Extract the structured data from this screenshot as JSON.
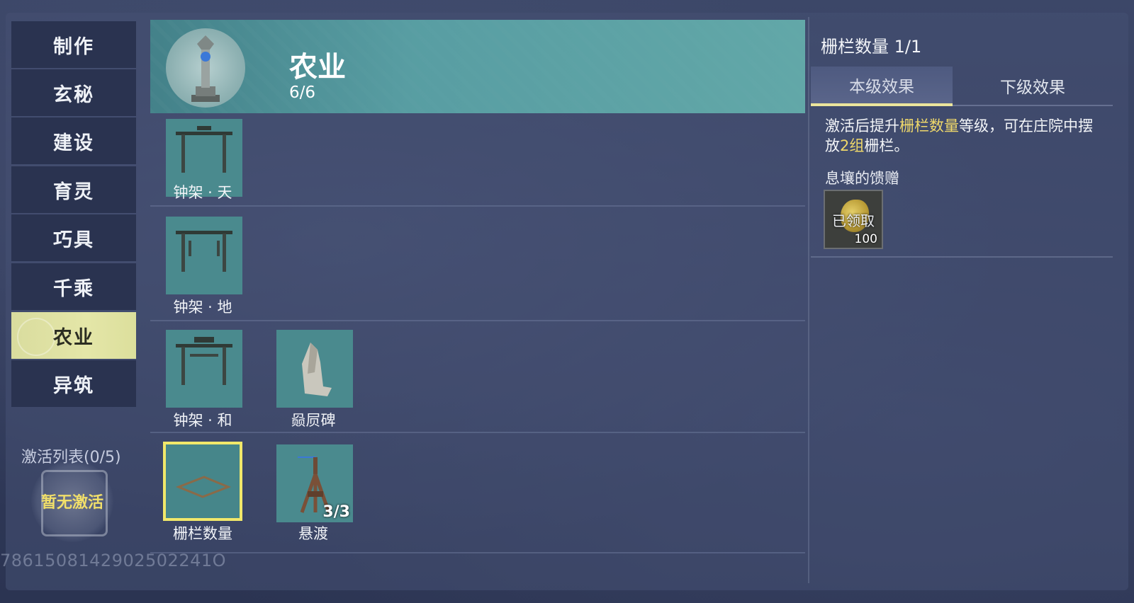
{
  "categories": [
    {
      "label": "制作"
    },
    {
      "label": "玄秘"
    },
    {
      "label": "建设"
    },
    {
      "label": "育灵"
    },
    {
      "label": "巧具"
    },
    {
      "label": "千乘"
    },
    {
      "label": "农业",
      "active": true
    },
    {
      "label": "异筑"
    }
  ],
  "activation": {
    "label": "激活列表(0/5)",
    "empty_text": "暂无激活"
  },
  "uid": "7861508142902502241O",
  "banner": {
    "title": "农业",
    "count": "6/6"
  },
  "items": [
    {
      "label": "钟架 · 天"
    },
    {
      "label": "钟架 · 地"
    },
    {
      "label": "钟架 · 和"
    },
    {
      "label": "赑屃碑"
    },
    {
      "label": "栅栏数量",
      "selected": true
    },
    {
      "label": "悬渡",
      "count": "3/3"
    }
  ],
  "detail": {
    "title": "栅栏数量 1/1",
    "tab_current": "本级效果",
    "tab_next": "下级效果",
    "desc_part1": "激活后提升",
    "desc_highlight1": "栅栏数量",
    "desc_part2": "等级，可在庄院中摆放",
    "desc_highlight2": "2组",
    "desc_part3": "栅栏。",
    "gift_label": "息壤的馈赠",
    "gift_status": "已领取",
    "gift_qty": "100"
  },
  "colors": {
    "accent_yellow": "#efd86a",
    "active_tab": "#e4e6a8",
    "tile_bg": "#4a8a8e",
    "selected_border": "#f1e86a"
  }
}
